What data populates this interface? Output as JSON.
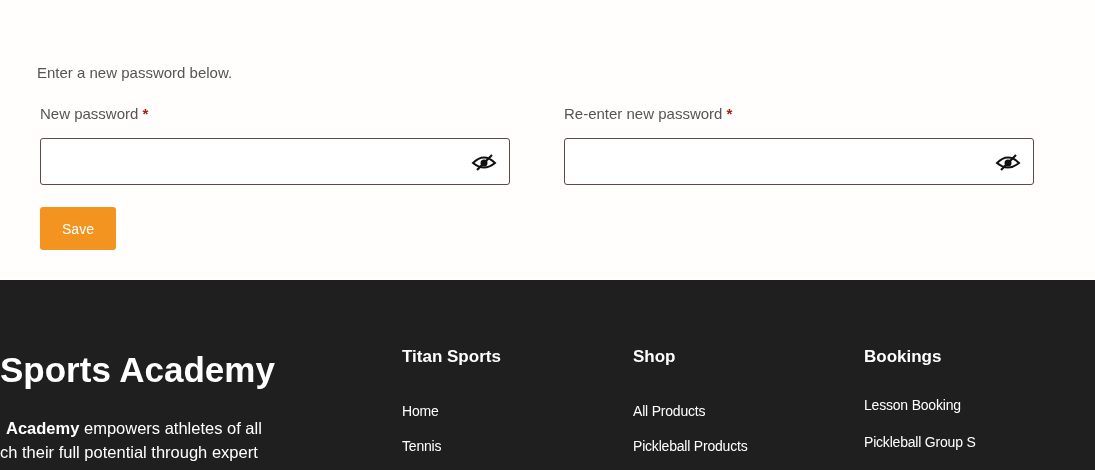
{
  "form": {
    "intro": "Enter a new password below.",
    "fields": [
      {
        "label": "New password",
        "required_mark": "*",
        "password_hidden": true
      },
      {
        "label": "Re-enter new password",
        "required_mark": "*",
        "password_hidden": true
      }
    ],
    "save_button": "Save"
  },
  "footer": {
    "brand": "Sports Academy",
    "about_lines": [
      "**Academy** empowers athletes of all",
      "ch their full potential through expert"
    ],
    "columns": [
      {
        "heading": "Titan Sports",
        "links": [
          "Home",
          "Tennis"
        ]
      },
      {
        "heading": "Shop",
        "links": [
          "All Products",
          "Pickleball Products"
        ]
      },
      {
        "heading": "Bookings",
        "links": [
          "Lesson Booking",
          "Pickleball Group S"
        ]
      }
    ]
  }
}
